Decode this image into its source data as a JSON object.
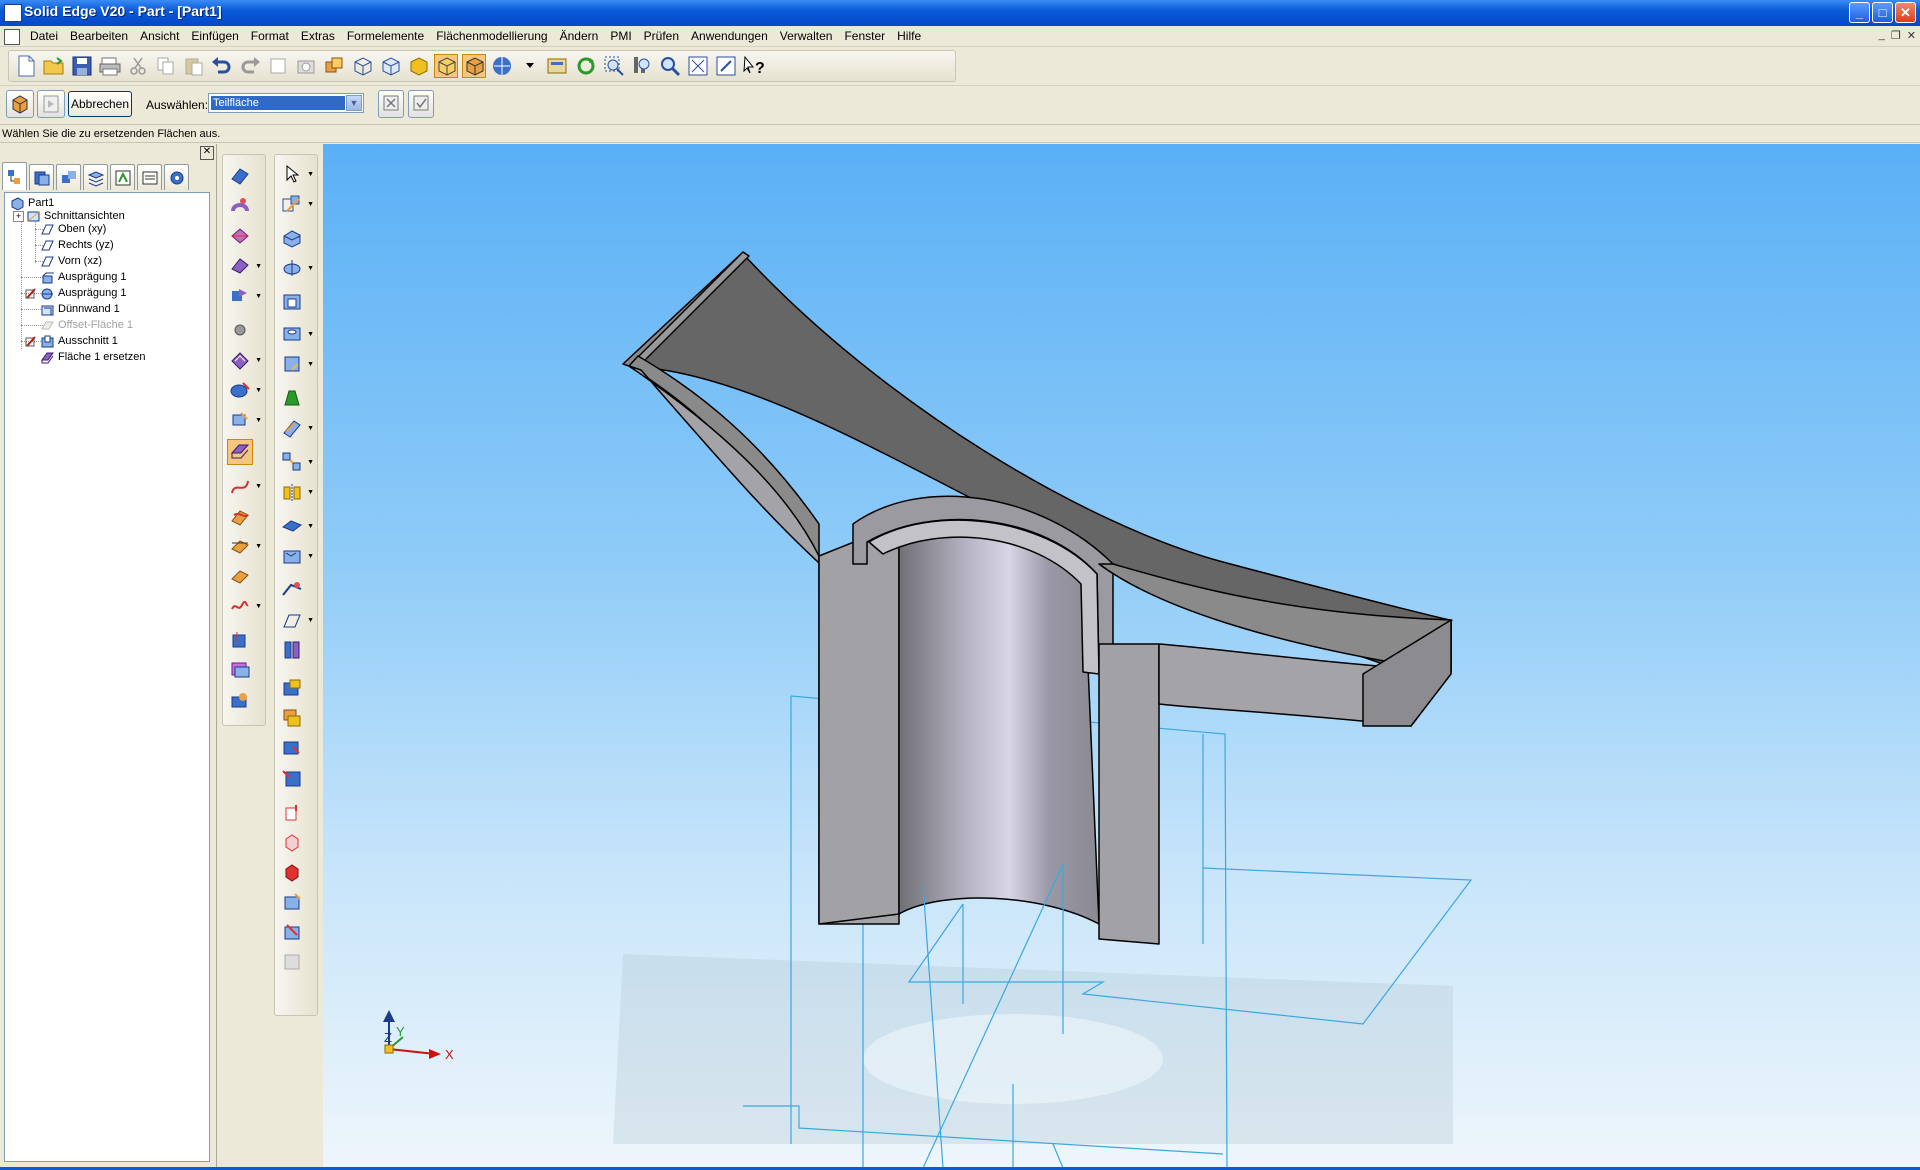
{
  "window": {
    "title": "Solid Edge V20 - Part - [Part1]",
    "minimize": "_",
    "maximize": "□",
    "close": "✕"
  },
  "menubar": {
    "items": [
      "Datei",
      "Bearbeiten",
      "Ansicht",
      "Einfügen",
      "Format",
      "Extras",
      "Formelemente",
      "Flächenmodellierung",
      "Ändern",
      "PMI",
      "Prüfen",
      "Anwendungen",
      "Verwalten",
      "Fenster",
      "Hilfe"
    ],
    "mdi_min": "_",
    "mdi_restore": "❐",
    "mdi_close": "✕"
  },
  "command_bar": {
    "cancel_label": "Abbrechen",
    "select_label": "Auswählen:",
    "select_value": "Teilfläche"
  },
  "prompt": "Wählen Sie die zu ersetzenden Flächen aus.",
  "feature_tree": {
    "items": [
      {
        "label": "Part1",
        "dim": false
      },
      {
        "label": "Schnittansichten",
        "dim": false
      },
      {
        "label": "Oben (xy)",
        "dim": false
      },
      {
        "label": "Rechts (yz)",
        "dim": false
      },
      {
        "label": "Vorn (xz)",
        "dim": false
      },
      {
        "label": "Ausprägung 1",
        "dim": false
      },
      {
        "label": "Ausprägung 1",
        "dim": false
      },
      {
        "label": "Dünnwand 1",
        "dim": false
      },
      {
        "label": "Offset-Fläche 1",
        "dim": true
      },
      {
        "label": "Ausschnitt 1",
        "dim": false
      },
      {
        "label": "Fläche 1 ersetzen",
        "dim": false
      }
    ]
  },
  "triad": {
    "z": "Z",
    "y": "Y",
    "x": "X"
  },
  "colors": {
    "titlebar": "#0a5bd8",
    "viewport_top": "#5ab0f6",
    "viewport_bottom": "#eef6fb",
    "active_tool": "#f5c77e",
    "plane_outline": "#3aa8e0"
  }
}
